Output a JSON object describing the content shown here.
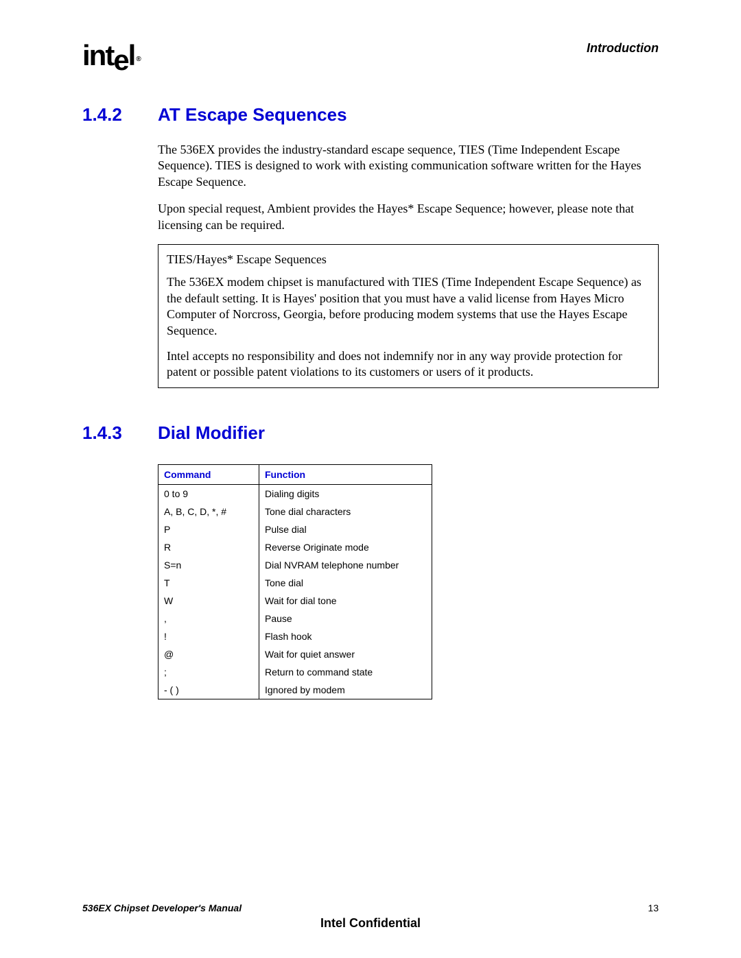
{
  "header": {
    "logo_text_1": "int",
    "logo_text_drop": "e",
    "logo_text_2": "l",
    "logo_reg": "®",
    "chapter": "Introduction"
  },
  "section_142": {
    "number": "1.4.2",
    "title": "AT Escape Sequences",
    "para1": "The 536EX provides the industry-standard escape sequence, TIES (Time Independent Escape Sequence). TIES is designed to work with existing communication software written for the Hayes Escape Sequence.",
    "para2": "Upon special request, Ambient provides the Hayes* Escape Sequence; however, please note that licensing can be required.",
    "note_title": "TIES/Hayes* Escape Sequences",
    "note_p1": "The 536EX modem chipset is manufactured with TIES (Time Independent Escape Sequence) as the default setting. It is Hayes' position that you must have a valid license from Hayes Micro Computer of Norcross, Georgia, before producing modem systems that use the Hayes Escape Sequence.",
    "note_p2": "Intel accepts no responsibility and does not indemnify nor in any way provide protection for patent or possible patent violations to its customers or users of it products."
  },
  "section_143": {
    "number": "1.4.3",
    "title": "Dial Modifier",
    "table": {
      "headers": {
        "command": "Command",
        "function": "Function"
      },
      "rows": [
        {
          "command": "0 to 9",
          "function": "Dialing digits"
        },
        {
          "command": "A, B, C, D, *, #",
          "function": "Tone dial characters"
        },
        {
          "command": "P",
          "function": "Pulse dial"
        },
        {
          "command": "R",
          "function": "Reverse Originate mode"
        },
        {
          "command": "S=n",
          "function": "Dial NVRAM telephone number"
        },
        {
          "command": "T",
          "function": "Tone dial"
        },
        {
          "command": "W",
          "function": "Wait for dial tone"
        },
        {
          "command": ",",
          "function": "Pause"
        },
        {
          "command": "!",
          "function": "Flash hook"
        },
        {
          "command": "@",
          "function": "Wait for quiet answer"
        },
        {
          "command": ";",
          "function": "Return to command state"
        },
        {
          "command": "- ( )",
          "function": "Ignored by modem"
        }
      ]
    }
  },
  "footer": {
    "manual": "536EX Chipset Developer's Manual",
    "page": "13",
    "confidential": "Intel Confidential"
  }
}
